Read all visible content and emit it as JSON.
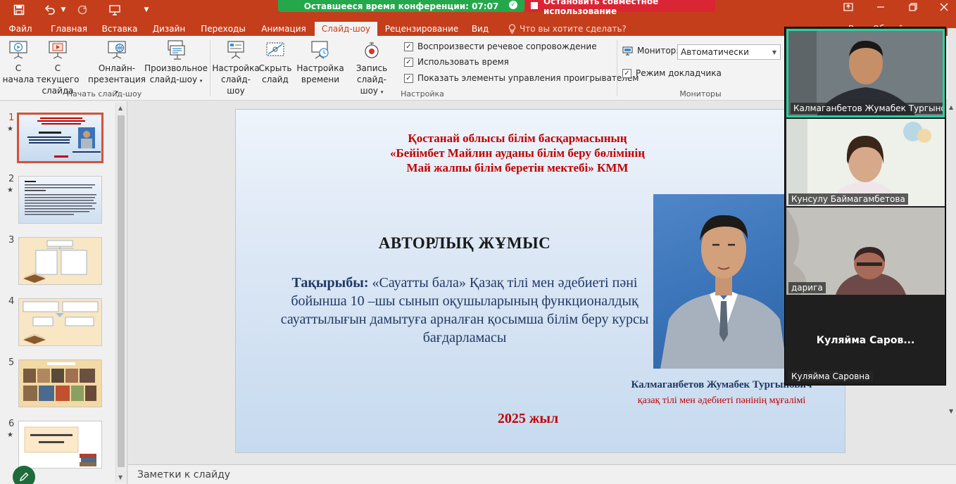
{
  "titlebar": {
    "conference_timer": "Оставшееся время конференции: 07:07",
    "stop_sharing": "Остановить совместное использование"
  },
  "tabs": [
    {
      "label": "Файл"
    },
    {
      "label": "Главная"
    },
    {
      "label": "Вставка"
    },
    {
      "label": "Дизайн"
    },
    {
      "label": "Переходы"
    },
    {
      "label": "Анимация"
    },
    {
      "label": "Слайд-шоу",
      "active": true
    },
    {
      "label": "Рецензирование"
    },
    {
      "label": "Вид"
    }
  ],
  "tell_me": "Что вы хотите сделать?",
  "user_area": "Вход   Общий доступ",
  "ribbon": {
    "start": {
      "group_label": "Начать слайд-шоу",
      "from_start": [
        "С",
        "начала"
      ],
      "from_current": [
        "С текущего",
        "слайда"
      ],
      "online": [
        "Онлайн-",
        "презентация"
      ],
      "custom": [
        "Произвольное",
        "слайд-шоу"
      ]
    },
    "setup": {
      "group_label": "Настройка",
      "setup_show": [
        "Настройка",
        "слайд-шоу"
      ],
      "hide_slide": [
        "Скрыть",
        "слайд"
      ],
      "rehearse": [
        "Настройка",
        "времени"
      ],
      "record": [
        "Запись слайд-",
        "шоу"
      ],
      "checks": [
        {
          "label": "Воспроизвести речевое сопровождение",
          "checked": true
        },
        {
          "label": "Использовать время",
          "checked": true
        },
        {
          "label": "Показать элементы управления проигрывателем",
          "checked": true
        }
      ]
    },
    "monitors": {
      "group_label": "Мониторы",
      "monitor_label": "Монитор:",
      "monitor_value": "Автоматически",
      "presenter_view": "Режим докладчика",
      "presenter_checked": true
    }
  },
  "thumbnails": [
    {
      "num": "1",
      "star": "★",
      "selected": true
    },
    {
      "num": "2",
      "star": "★"
    },
    {
      "num": "3"
    },
    {
      "num": "4"
    },
    {
      "num": "5"
    },
    {
      "num": "6",
      "star": "★"
    }
  ],
  "slide": {
    "header_lines": [
      "Қостанай облысы білім басқармасының",
      "«Бейімбет Майлин ауданы  білім беру бөлімінің",
      "Май жалпы білім беретін  мектебі» КММ"
    ],
    "title": "АВТОРЛЫҚ ЖҰМЫС",
    "topic_label": "Тақырыбы:",
    "topic_text": " «Сауатты бала» Қазақ тілі мен әдебиеті пәні бойынша 10 –шы сынып оқушыларының функционалдық сауаттылығын  дамытуға арналған қосымша білім беру курсы бағдарламасы",
    "author": "Калмаганбетов Жумабек Тургынович",
    "role": "қазақ тілі мен әдебиеті пәнінің мұғалімі",
    "year": "2025 жыл"
  },
  "notes_placeholder": "Заметки к слайду",
  "participants": [
    {
      "name": "Калмаганбетов Жумабек Тургыно...",
      "active": true
    },
    {
      "name": "Кунсулу Баймагамбетова"
    },
    {
      "name": "дарига"
    },
    {
      "name": "Куляйма Саровна",
      "display": "Куляйма  Саров..."
    }
  ],
  "colors": {
    "accent": "#c43e1c",
    "timer_green": "#25a84b",
    "stop_red": "#d92534",
    "slide_red": "#c00000",
    "slide_blue": "#1f3864",
    "active_speaker": "#2ad1a0"
  }
}
